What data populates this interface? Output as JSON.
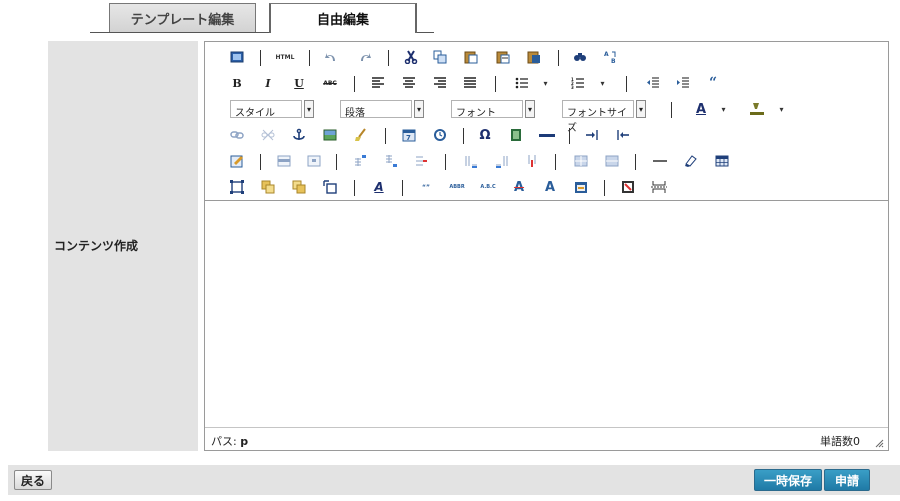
{
  "tabs": {
    "template_label": "テンプレート編集",
    "free_label": "自由編集"
  },
  "form": {
    "content_label": "コンテンツ作成"
  },
  "toolbar": {
    "style_select": "スタイル",
    "paragraph_select": "段落",
    "font_select": "フォント",
    "font_size_select": "フォントサイズ",
    "html_label": "HTML",
    "bold_label": "B",
    "italic_label": "I",
    "underline_label": "U",
    "strike_label": "ABC",
    "quote_label": "“",
    "text_color_label": "A",
    "omega_label": "Ω",
    "citation_label": "“”",
    "abbr_label": "ABBR",
    "acronym_label": "A.B.C"
  },
  "statusbar": {
    "path_label": "パス:",
    "path_value": "p",
    "word_count": "単語数0"
  },
  "footer": {
    "back_label": "戻る",
    "temp_save_label": "一時保存",
    "apply_label": "申請"
  },
  "colors": {
    "primary_button": "#2a8bb8",
    "label_bg": "#e3e3e3"
  }
}
